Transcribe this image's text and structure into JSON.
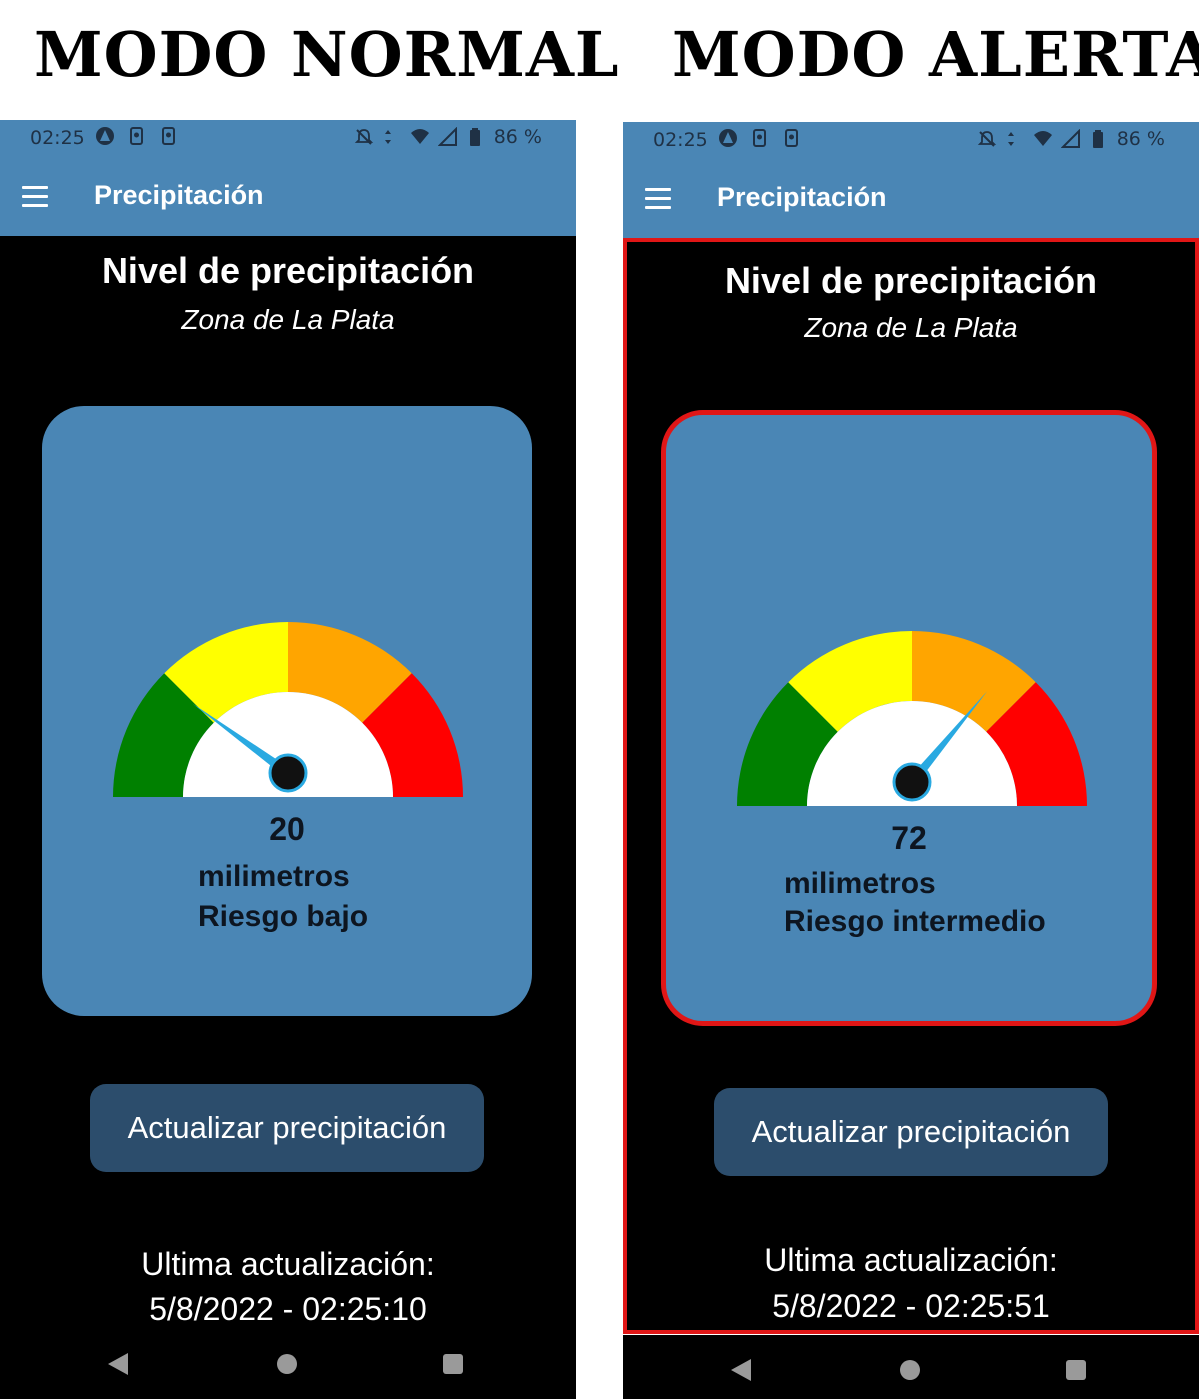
{
  "left": {
    "mode_title": "MODO NORMAL",
    "status": {
      "time": "02:25",
      "battery": "86 %"
    },
    "app_bar": {
      "title": "Precipitación"
    },
    "heading": "Nivel de precipitación",
    "subheading": "Zona de La Plata",
    "gauge": {
      "value": "20",
      "unit": "milimetros",
      "risk": "Riesgo bajo",
      "needle_fraction": 0.2
    },
    "button": "Actualizar precipitación",
    "last_update_label": "Ultima actualización:",
    "last_update_time": "5/8/2022 - 02:25:10"
  },
  "right": {
    "mode_title": "MODO ALERTA",
    "status": {
      "time": "02:25",
      "battery": "86 %"
    },
    "app_bar": {
      "title": "Precipitación"
    },
    "heading": "Nivel de precipitación",
    "subheading": "Zona de La Plata",
    "gauge": {
      "value": "72",
      "unit": "milimetros",
      "risk": "Riesgo intermedio",
      "needle_fraction": 0.72
    },
    "button": "Actualizar precipitación",
    "last_update_label": "Ultima actualización:",
    "last_update_time": "5/8/2022 - 02:25:51"
  },
  "colors": {
    "bar": "#4a86b5",
    "button": "#2c4d6c",
    "alert_border": "#e01616",
    "gauge_green": "#008000",
    "gauge_yellow": "#ffff00",
    "gauge_orange": "#ffa500",
    "gauge_red": "#ff0000"
  }
}
